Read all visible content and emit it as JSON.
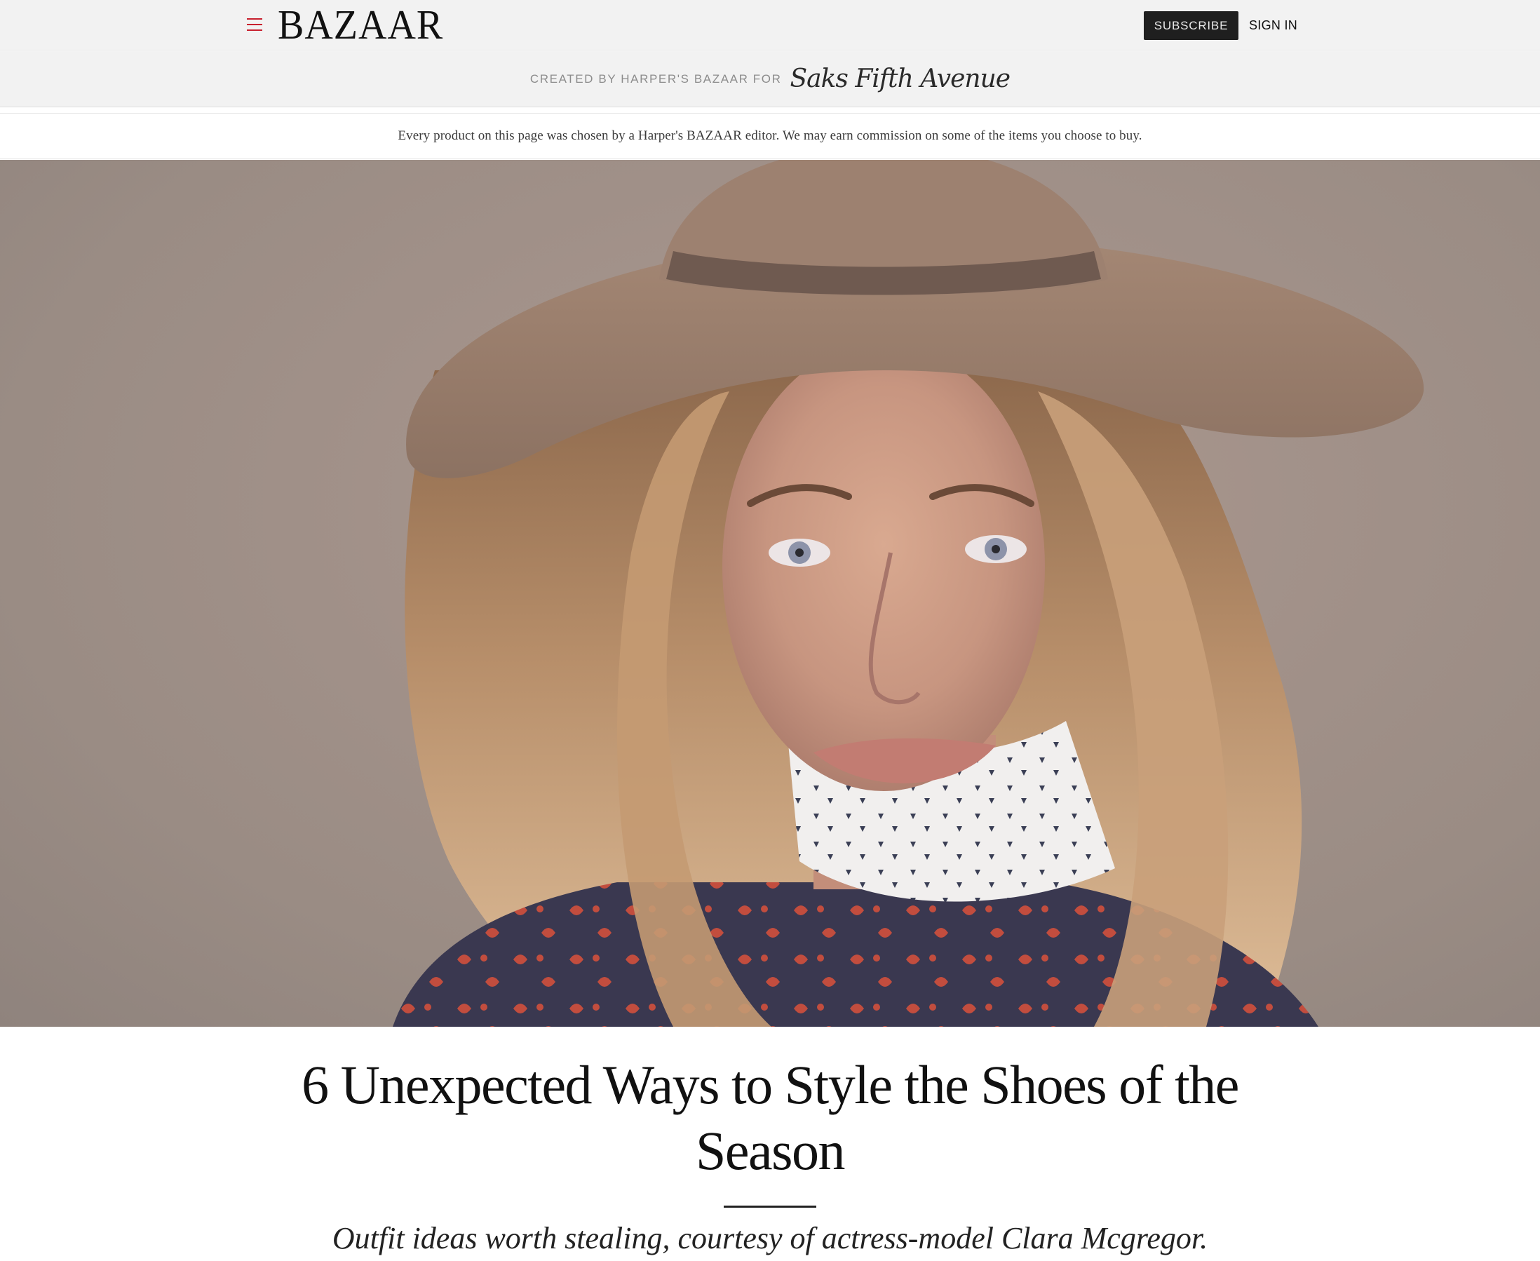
{
  "header": {
    "logo_text": "BAZAAR",
    "subscribe_label": "SUBSCRIBE",
    "signin_label": "SIGN IN",
    "accent_color": "#c8202e"
  },
  "sponsor": {
    "created_by": "CREATED BY HARPER'S BAZAAR FOR",
    "partner_logo_text": "Saks Fifth Avenue"
  },
  "disclaimer": {
    "text": "Every product on this page was chosen by a Harper's BAZAAR editor. We may earn commission on some of the items you choose to buy."
  },
  "article": {
    "headline": "6 Unexpected Ways to Style the Shoes of the Season",
    "dek": "Outfit ideas worth stealing, courtesy of actress-model Clara Mcgregor."
  },
  "icons": {
    "menu": "hamburger-menu-icon"
  }
}
